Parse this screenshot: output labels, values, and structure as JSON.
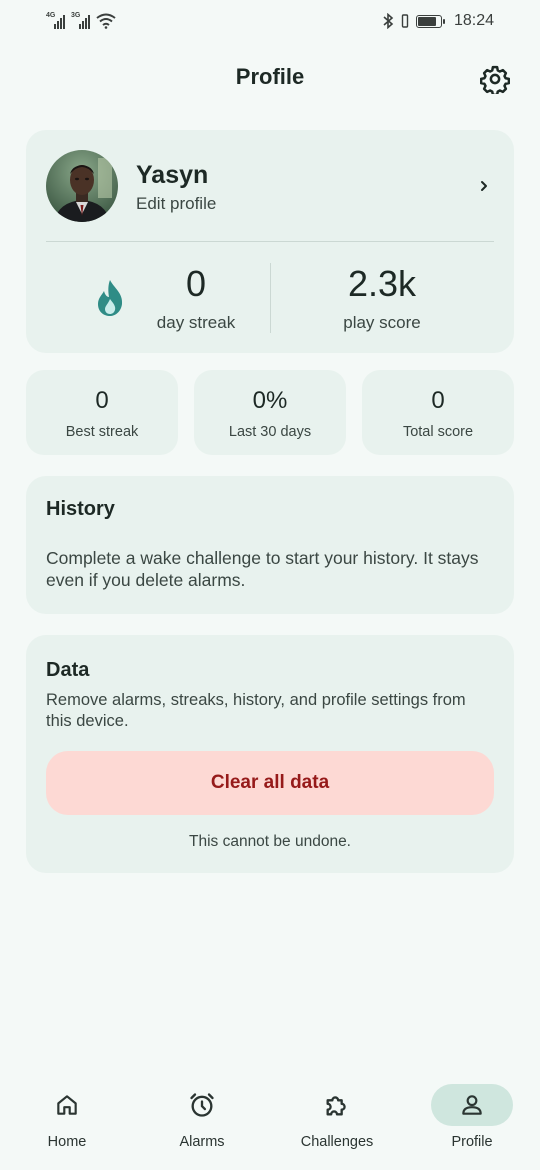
{
  "status_bar": {
    "signal_1_tag": "4G",
    "signal_2_tag": "3G",
    "time": "18:24"
  },
  "header": {
    "title": "Profile",
    "settings_icon": "gear-icon"
  },
  "profile": {
    "name": "Yasyn",
    "edit_label": "Edit profile",
    "streak_value": "0",
    "streak_label": "day streak",
    "score_value": "2.3k",
    "score_label": "play score"
  },
  "mini_stats": [
    {
      "value": "0",
      "label": "Best streak"
    },
    {
      "value": "0%",
      "label": "Last 30 days"
    },
    {
      "value": "0",
      "label": "Total score"
    }
  ],
  "history": {
    "title": "History",
    "text": "Complete a wake challenge to start your history. It stays even if you delete alarms."
  },
  "data_section": {
    "title": "Data",
    "text": "Remove alarms, streaks, history, and profile settings from this device.",
    "clear_button": "Clear all data",
    "note": "This cannot be undone."
  },
  "nav": [
    {
      "label": "Home",
      "icon": "home-icon"
    },
    {
      "label": "Alarms",
      "icon": "alarm-clock-icon"
    },
    {
      "label": "Challenges",
      "icon": "puzzle-icon"
    },
    {
      "label": "Profile",
      "icon": "user-icon"
    }
  ],
  "colors": {
    "background": "#f4f9f7",
    "card": "#e8f2ee",
    "danger_bg": "#fdd9d4",
    "danger_text": "#961a1a",
    "accent": "#2f8c86"
  }
}
